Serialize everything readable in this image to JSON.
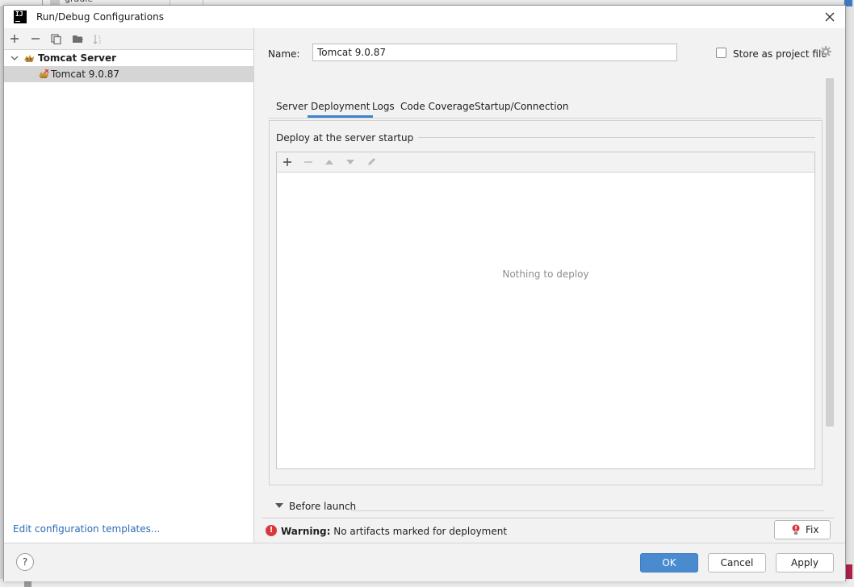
{
  "background": {
    "top_fragment": "gradle"
  },
  "dialog": {
    "title": "Run/Debug Configurations",
    "app_icon_text": "IJ"
  },
  "left_toolbar": {
    "icons": [
      "add-icon",
      "remove-icon",
      "copy-icon",
      "folder-icon",
      "sort-icon"
    ]
  },
  "tree": {
    "items": [
      {
        "label": "Tomcat Server",
        "expanded": true
      },
      {
        "label": "Tomcat 9.0.87",
        "selected": true
      }
    ]
  },
  "edit_templates_link": "Edit configuration templates...",
  "name_field": {
    "label": "Name:",
    "value": "Tomcat 9.0.87"
  },
  "store_as_project_file": {
    "label": "Store as project file",
    "checked": false
  },
  "tabs": [
    {
      "label": "Server"
    },
    {
      "label": "Deployment",
      "active": true
    },
    {
      "label": "Logs"
    },
    {
      "label": "Code Coverage"
    },
    {
      "label": "Startup/Connection"
    }
  ],
  "deployment": {
    "section_title": "Deploy at the server startup",
    "empty_text": "Nothing to deploy",
    "toolbar_icons": [
      "add-icon",
      "remove-icon",
      "move-up-icon",
      "move-down-icon",
      "edit-icon"
    ]
  },
  "before_launch": {
    "label": "Before launch"
  },
  "warning": {
    "prefix": "Warning:",
    "message": "No artifacts marked for deployment",
    "fix_label": "Fix"
  },
  "footer": {
    "help_label": "?",
    "ok_label": "OK",
    "cancel_label": "Cancel",
    "apply_label": "Apply"
  },
  "colors": {
    "accent": "#4a8bd0",
    "link": "#2d6bb7",
    "error": "#d9383a",
    "tab_underline": "#4083c9"
  }
}
